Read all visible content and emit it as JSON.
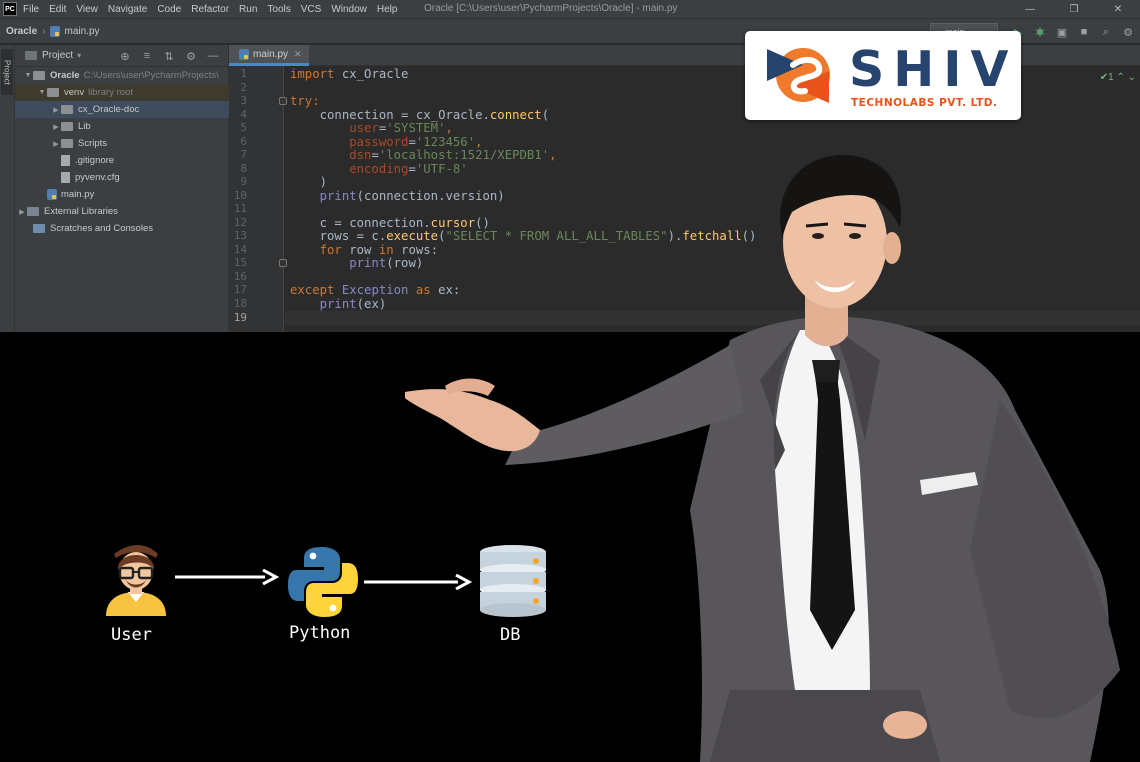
{
  "app": {
    "logo_text": "PC",
    "menu": [
      "File",
      "Edit",
      "View",
      "Navigate",
      "Code",
      "Refactor",
      "Run",
      "Tools",
      "VCS",
      "Window",
      "Help"
    ],
    "window_title": "Oracle [C:\\Users\\user\\PycharmProjects\\Oracle] - main.py",
    "window_controls": [
      "—",
      "❐",
      "✕"
    ]
  },
  "navbar": {
    "project": "Oracle",
    "file": "main.py",
    "run_config": "main",
    "toolbar_icons": [
      "run-icon",
      "debug-icon",
      "coverage-icon",
      "stop-icon",
      "search-icon",
      "settings-icon"
    ]
  },
  "left_strip": {
    "tab_label": "Project"
  },
  "project_panel": {
    "title": "Project",
    "tools": [
      "⊕",
      "≡",
      "⇅",
      "⚙",
      "—"
    ],
    "tree": [
      {
        "label": "Oracle",
        "meta": "C:\\Users\\user\\PycharmProjects\\"
      },
      {
        "label": "venv",
        "meta": "library root"
      },
      {
        "label": "cx_Oracle-doc"
      },
      {
        "label": "Lib"
      },
      {
        "label": "Scripts"
      },
      {
        "label": ".gitignore"
      },
      {
        "label": "pyvenv.cfg"
      },
      {
        "label": "main.py"
      },
      {
        "label": "External Libraries"
      },
      {
        "label": "Scratches and Consoles"
      }
    ]
  },
  "editor": {
    "tab": "main.py",
    "tab_close": "✕",
    "line_numbers": [
      "1",
      "2",
      "3",
      "4",
      "5",
      "6",
      "7",
      "8",
      "9",
      "10",
      "11",
      "12",
      "13",
      "14",
      "15",
      "16",
      "17",
      "18",
      "19"
    ],
    "current_line": "19",
    "inspections": "✔1 ⌃ ⌄",
    "code": {
      "l1_kw": "import",
      "l1_rest": " cx_Oracle",
      "l3_kw": "try",
      "l3_rest": ":",
      "l4_a": "    connection = cx_Oracle.",
      "l4_fn": "connect",
      "l4_b": "(",
      "l5_p": "        user",
      "l5_eq": "=",
      "l5_s": "'SYSTEM'",
      "l5_c": ",",
      "l6_p": "        password",
      "l6_eq": "=",
      "l6_s": "'123456'",
      "l6_c": ",",
      "l7_p": "        dsn",
      "l7_eq": "=",
      "l7_s": "'localhost:1521/XEPDB1'",
      "l7_c": ",",
      "l8_p": "        encoding",
      "l8_eq": "=",
      "l8_s": "'UTF-8'",
      "l9": "    )",
      "l10_fn": "    print",
      "l10_rest": "(connection.version)",
      "l12_a": "    c = connection.",
      "l12_fn": "cursor",
      "l12_b": "()",
      "l13_a": "    rows = c.",
      "l13_fn": "execute",
      "l13_b": "(",
      "l13_s": "\"SELECT * FROM ALL_ALL_TABLES\"",
      "l13_c": ").",
      "l13_fn2": "fetchall",
      "l13_d": "()",
      "l14_kw": "    for",
      "l14_a": " row ",
      "l14_kw2": "in",
      "l14_b": " rows:",
      "l15_fn": "        print",
      "l15_rest": "(row)",
      "l17_kw": "except",
      "l17_bi": " Exception",
      "l17_kw2": " as",
      "l17_rest": " ex:",
      "l18_fn": "    print",
      "l18_rest": "(ex)"
    }
  },
  "brand": {
    "name": "SHIV",
    "subtitle": "TECHNOLABS PVT. LTD.",
    "colors": {
      "navy": "#27446e",
      "orange": "#e8531c",
      "ring": "#f07a2b"
    }
  },
  "diagram": {
    "nodes": [
      {
        "label": "User",
        "icon": "user-icon"
      },
      {
        "label": "Python",
        "icon": "python-logo-icon"
      },
      {
        "label": "DB",
        "icon": "database-icon"
      }
    ]
  }
}
